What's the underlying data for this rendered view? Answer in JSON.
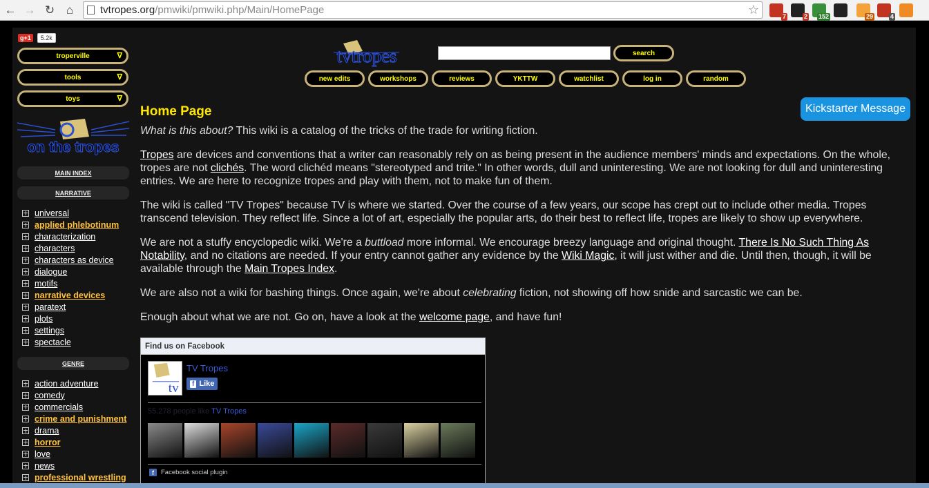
{
  "browser": {
    "url_domain": "tvtropes.org",
    "url_path": "/pmwiki/pmwiki.php/Main/HomePage",
    "extensions": [
      {
        "name": "gmail-icon",
        "badge": "7",
        "color": "#c23321",
        "badge_color": "#c23321"
      },
      {
        "name": "extension-s-icon",
        "badge": "2",
        "color": "#222222",
        "badge_color": "#c23321"
      },
      {
        "name": "mail-checker-icon",
        "badge": "152",
        "color": "#3a8f3a",
        "badge_color": "#2f7d2f"
      },
      {
        "name": "readability-icon",
        "badge": "",
        "color": "#222222",
        "badge_color": "#000"
      },
      {
        "name": "rss-feed-icon",
        "badge": "29",
        "color": "#f3a33a",
        "badge_color": "#c25a00"
      },
      {
        "name": "adblock-plus-icon",
        "badge": "4",
        "color": "#c23321",
        "badge_color": "#555"
      },
      {
        "name": "rss-icon",
        "badge": "",
        "color": "#f08a24",
        "badge_color": "#000"
      }
    ]
  },
  "sidebar": {
    "gplus_label": "g+1",
    "gplus_count": "5.2k",
    "dropdowns": [
      "troperville",
      "tools",
      "toys"
    ],
    "dropdown_arrow": "∇",
    "logo_text": "on the tropes",
    "sections": [
      {
        "title": "MAIN INDEX",
        "items": []
      },
      {
        "title": "NARRATIVE",
        "items": [
          {
            "label": "universal",
            "hl": false
          },
          {
            "label": "applied phlebotinum",
            "hl": true
          },
          {
            "label": "characterization",
            "hl": false
          },
          {
            "label": "characters",
            "hl": false
          },
          {
            "label": "characters as device",
            "hl": false
          },
          {
            "label": "dialogue",
            "hl": false
          },
          {
            "label": "motifs",
            "hl": false
          },
          {
            "label": "narrative devices",
            "hl": true
          },
          {
            "label": "paratext",
            "hl": false
          },
          {
            "label": "plots",
            "hl": false
          },
          {
            "label": "settings",
            "hl": false
          },
          {
            "label": "spectacle",
            "hl": false
          }
        ]
      },
      {
        "title": "GENRE",
        "items": [
          {
            "label": "action adventure",
            "hl": false
          },
          {
            "label": "comedy",
            "hl": false
          },
          {
            "label": "commercials",
            "hl": false
          },
          {
            "label": "crime and punishment",
            "hl": true
          },
          {
            "label": "drama",
            "hl": false
          },
          {
            "label": "horror",
            "hl": true
          },
          {
            "label": "love",
            "hl": false
          },
          {
            "label": "news",
            "hl": false
          },
          {
            "label": "professional wrestling",
            "hl": true
          }
        ]
      }
    ]
  },
  "header": {
    "logo_text": "tvtropes",
    "search_value": "",
    "search_button": "search",
    "nav": [
      "new edits",
      "workshops",
      "reviews",
      "YKTTW",
      "watchlist",
      "log in",
      "random"
    ]
  },
  "kickstarter": "Kickstarter Message",
  "main": {
    "title": "Home Page",
    "p1": {
      "em": "What is this about?",
      "text": " This wiki is a catalog of the tricks of the trade for writing fiction."
    },
    "p2": {
      "link1": "Tropes",
      "t1": " are devices and conventions that a writer can reasonably rely on as being present in the audience members' minds and expectations. On the whole, tropes are not ",
      "link2": "clichés",
      "t2": ". The word clichéd means \"stereotyped and trite.\" In other words, dull and uninteresting. We are not looking for dull and uninteresting entries. We are here to recognize tropes and play with them, not to make fun of them."
    },
    "p3": "The wiki is called \"TV Tropes\" because TV is where we started. Over the course of a few years, our scope has crept out to include other media. Tropes transcend television. They reflect life. Since a lot of art, especially the popular arts, do their best to reflect life, tropes are likely to show up everywhere.",
    "p4": {
      "t1": "We are not a stuffy encyclopedic wiki. We're a ",
      "em": "buttload",
      "t2": " more informal. We encourage breezy language and original thought. ",
      "link1": "There Is No Such Thing As Notability",
      "t3": ", and no citations are needed. If your entry cannot gather any evidence by the ",
      "link2": "Wiki Magic",
      "t4": ", it will just wither and die. Until then, though, it will be available through the ",
      "link3": "Main Tropes Index",
      "t5": "."
    },
    "p5": {
      "t1": "We are also not a wiki for bashing things. Once again, we're about ",
      "em": "celebrating",
      "t2": " fiction, not showing off how snide and sarcastic we can be."
    },
    "p6": {
      "t1": "Enough about what we are not. Go on, have a look at the ",
      "link": "welcome page",
      "t2": ", and have fun!"
    }
  },
  "facebook": {
    "header": "Find us on Facebook",
    "page_name": "TV Tropes",
    "like_label": "Like",
    "likes_prefix": "55,278 people like ",
    "likes_page": "TV Tropes",
    "plugin_label": "Facebook social plugin",
    "face_colors": [
      "#8a8a8a",
      "#dddddd",
      "#a8452a",
      "#3a4a9a",
      "#1aa5c8",
      "#5a2a2a",
      "#3a3a3a",
      "#d9d0a0",
      "#6a7a5a"
    ]
  }
}
